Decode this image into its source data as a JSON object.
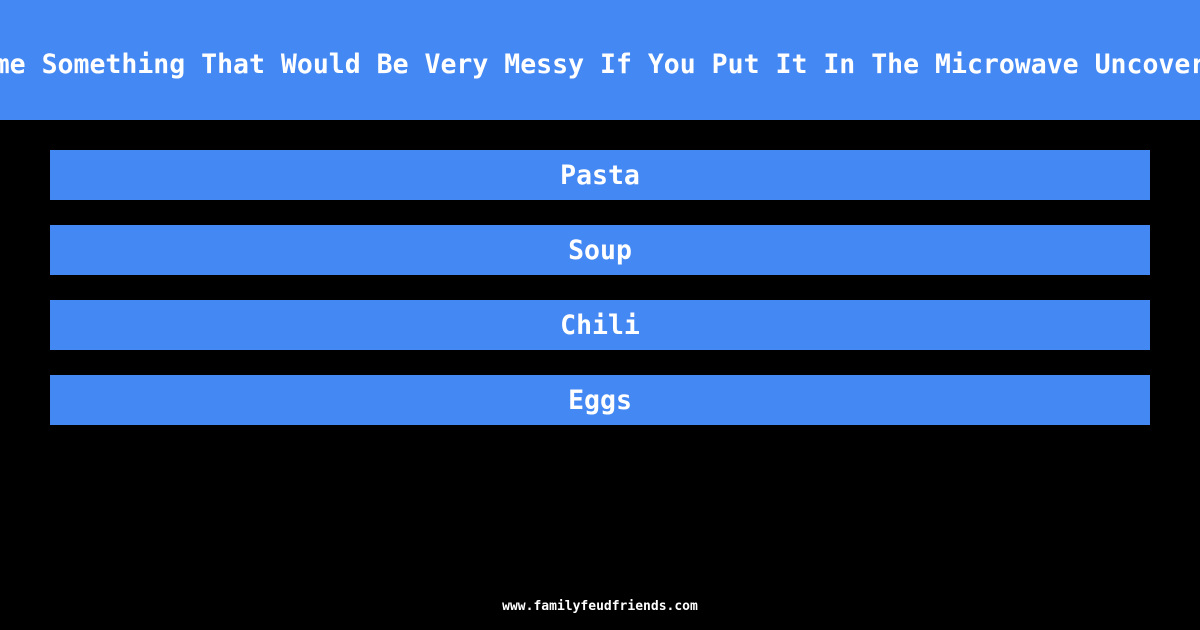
{
  "question": "Name Something That Would Be Very Messy If You Put It In The Microwave Uncovered",
  "answers": [
    {
      "label": "Pasta"
    },
    {
      "label": "Soup"
    },
    {
      "label": "Chili"
    },
    {
      "label": "Eggs"
    }
  ],
  "footer": {
    "site": "www.familyfeudfriends.com"
  },
  "colors": {
    "accent": "#4488f3",
    "background": "#000000",
    "text": "#ffffff"
  }
}
